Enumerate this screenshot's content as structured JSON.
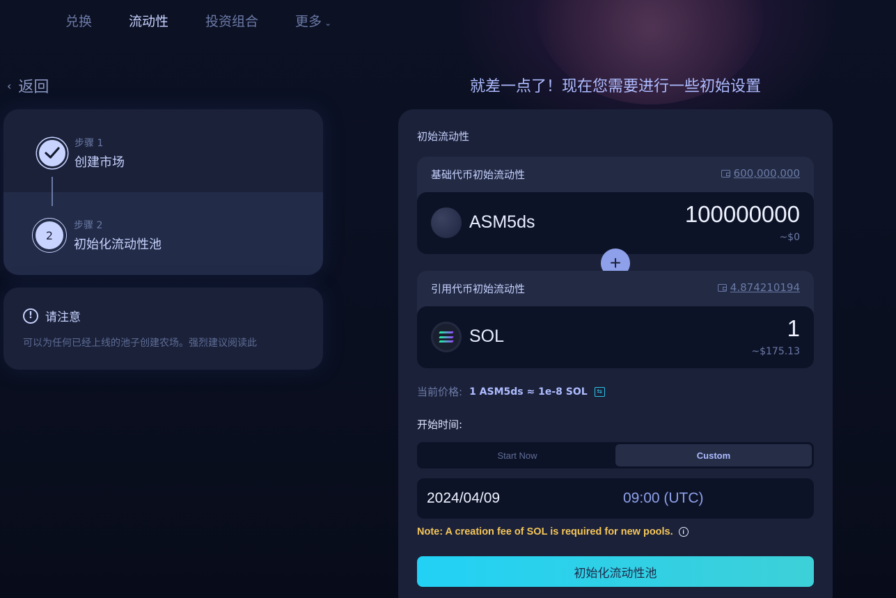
{
  "nav": {
    "items": [
      {
        "label": "兑换",
        "active": false
      },
      {
        "label": "流动性",
        "active": true
      },
      {
        "label": "投资组合",
        "active": false
      },
      {
        "label": "更多",
        "active": false
      }
    ],
    "more_icon": "chevron-down-icon"
  },
  "back_label": "返回",
  "heading": "就差一点了！现在您需要进行一些初始设置",
  "steps": [
    {
      "sub": "步骤 1",
      "title": "创建市场",
      "status": "done"
    },
    {
      "sub": "步骤 2",
      "title": "初始化流动性池",
      "number": "2",
      "status": "current"
    }
  ],
  "notice": {
    "title": "请注意",
    "text": "可以为任何已经上线的池子创建农场。强烈建议阅读此"
  },
  "panel": {
    "label": "初始流动性",
    "base": {
      "label": "基础代币初始流动性",
      "balance": "600,000,000",
      "token": "ASM5ds",
      "amount": "100000000",
      "usd": "~$0"
    },
    "quote": {
      "label": "引用代币初始流动性",
      "balance": "4.874210194",
      "token": "SOL",
      "amount": "1",
      "usd": "~$175.13"
    },
    "plus_symbol": "+",
    "price_label": "当前价格:",
    "price_value": "1 ASM5ds ≈ 1e-8 SOL",
    "start_label": "开始时间:",
    "toggle": {
      "start_now": "Start Now",
      "custom": "Custom",
      "selected": "Custom"
    },
    "date": "2024/04/09",
    "time": "09:00 (UTC)",
    "note": "Note: A creation fee of  SOL is required for new pools.",
    "cta": "初始化流动性池"
  },
  "colors": {
    "accent": "#c8d3ff",
    "cta_start": "#22d1f5",
    "cta_end": "#3dd0d8",
    "note": "#f5c65a",
    "panel_bg": "#1b2139"
  }
}
